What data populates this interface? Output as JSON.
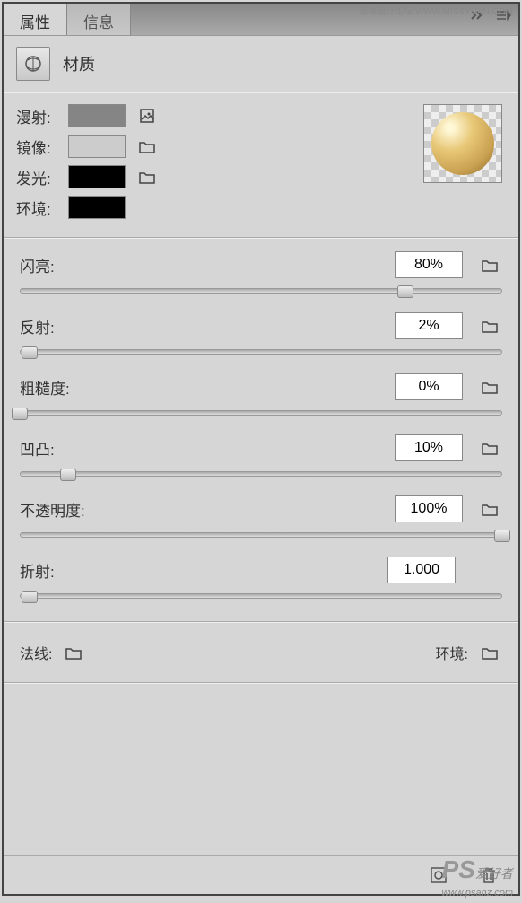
{
  "watermark_top": "思缘设计论坛 WWW.MISSYUAN.COM",
  "watermark_bottom_ps": "PS",
  "watermark_bottom_text": "爱好者",
  "watermark_bottom_url": "www.psahz.com",
  "tabs": {
    "properties": "属性",
    "info": "信息"
  },
  "header": {
    "title": "材质"
  },
  "colors": {
    "diffuse": {
      "label": "漫射:",
      "value": "#858585"
    },
    "specular": {
      "label": "镜像:",
      "value": "#cccccc"
    },
    "glow": {
      "label": "发光:",
      "value": "#000000"
    },
    "ambient": {
      "label": "环境:",
      "value": "#000000"
    }
  },
  "sliders": {
    "shine": {
      "label": "闪亮:",
      "value": "80%",
      "pos": 80
    },
    "reflection": {
      "label": "反射:",
      "value": "2%",
      "pos": 2
    },
    "roughness": {
      "label": "粗糙度:",
      "value": "0%",
      "pos": 0
    },
    "bump": {
      "label": "凹凸:",
      "value": "10%",
      "pos": 10
    },
    "opacity": {
      "label": "不透明度:",
      "value": "100%",
      "pos": 100
    },
    "refraction": {
      "label": "折射:",
      "value": "1.000",
      "pos": 2
    }
  },
  "bottom": {
    "normal": "法线:",
    "environment": "环境:"
  }
}
